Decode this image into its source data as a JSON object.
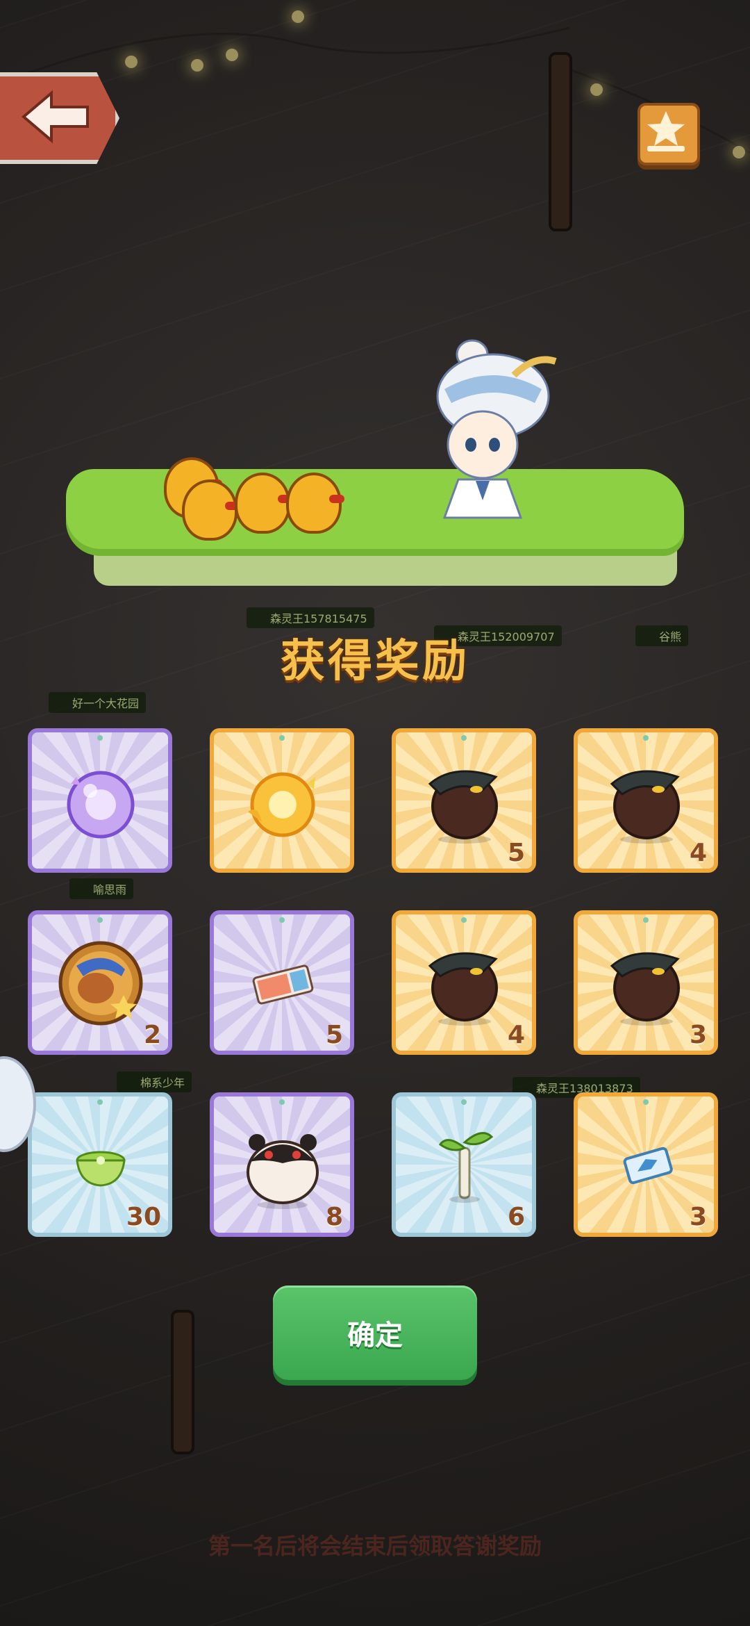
{
  "scene": {
    "player_names": [
      "森灵王157815475",
      "森灵王152009707",
      "谷熊",
      "好一个大花园",
      "喻思雨",
      "棉系少年",
      "森灵王138013873"
    ]
  },
  "header": {
    "back_icon": "back-arrow-icon",
    "rank_icon": "star-rank-icon"
  },
  "rewards": {
    "title": "获得奖励",
    "items": [
      {
        "icon": "purple-crystal-orb-icon",
        "rarity": "purple",
        "count": ""
      },
      {
        "icon": "gold-crystal-orb-icon",
        "rarity": "gold",
        "count": ""
      },
      {
        "icon": "crow-egg-icon",
        "rarity": "gold",
        "count": "5"
      },
      {
        "icon": "crow-egg-icon",
        "rarity": "gold",
        "count": "4"
      },
      {
        "icon": "bear-badge-icon",
        "rarity": "purple",
        "count": "2"
      },
      {
        "icon": "ticket-icon",
        "rarity": "purple",
        "count": "5"
      },
      {
        "icon": "crow-egg-icon",
        "rarity": "gold",
        "count": "4"
      },
      {
        "icon": "crow-egg-icon",
        "rarity": "gold",
        "count": "3"
      },
      {
        "icon": "green-tea-bowl-icon",
        "rarity": "blue",
        "count": "30"
      },
      {
        "icon": "panda-egg-icon",
        "rarity": "purple",
        "count": "8"
      },
      {
        "icon": "sapling-icon",
        "rarity": "blue",
        "count": "6"
      },
      {
        "icon": "blue-card-icon",
        "rarity": "gold",
        "count": "3"
      }
    ]
  },
  "actions": {
    "confirm_label": "确定"
  },
  "footer": {
    "text": "第一名后将会结束后领取答谢奖励"
  }
}
